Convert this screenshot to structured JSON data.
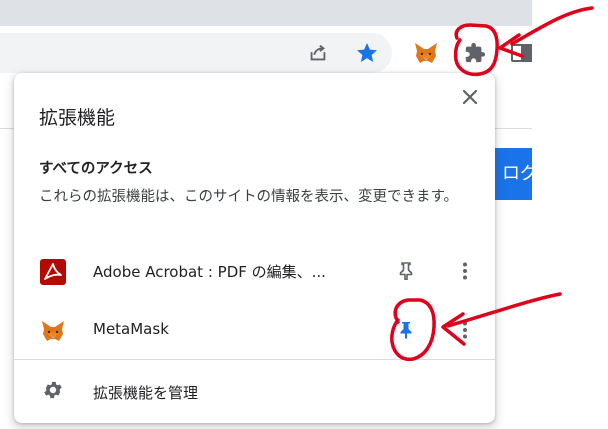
{
  "popup": {
    "title": "拡張機能",
    "section_heading": "すべてのアクセス",
    "section_desc": "これらの拡張機能は、このサイトの情報を表示、変更できます。",
    "extensions": [
      {
        "name": "Adobe Acrobat : PDF の編集、...",
        "icon": "adobe-acrobat-icon",
        "pinned": false
      },
      {
        "name": "MetaMask",
        "icon": "metamask-fox-icon",
        "pinned": true
      }
    ],
    "manage_label": "拡張機能を管理"
  },
  "page": {
    "button_text": "ログ"
  },
  "toolbar": {
    "icons": [
      "share-icon",
      "star-icon",
      "metamask-fox-icon",
      "extensions-puzzle-icon",
      "sidebar-icon"
    ]
  },
  "colors": {
    "accent_blue": "#1a73e8",
    "annotation_red": "#e0001b",
    "icon_gray": "#5f6368",
    "acrobat_red": "#b30b00",
    "fox_orange": "#e2761b"
  }
}
